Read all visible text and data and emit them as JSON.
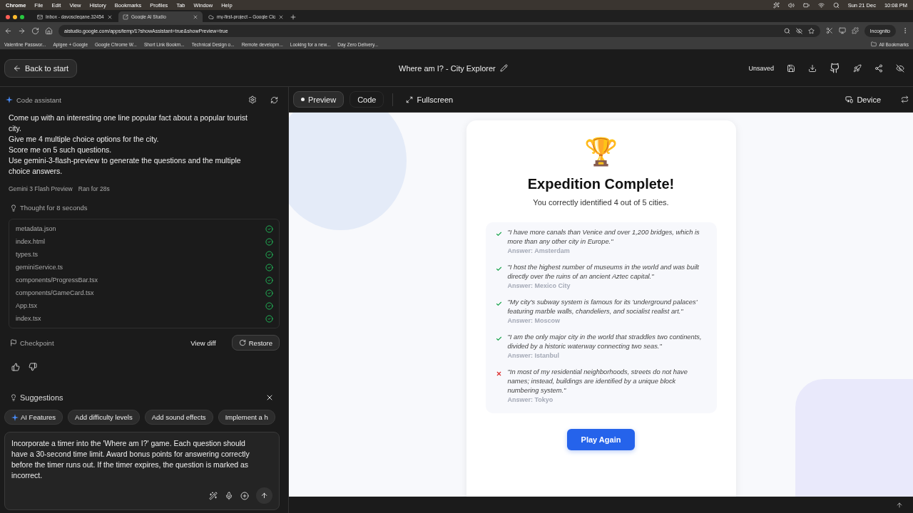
{
  "menu_bar": {
    "app": "Chrome",
    "items": [
      "File",
      "Edit",
      "View",
      "History",
      "Bookmarks",
      "Profiles",
      "Tab",
      "Window",
      "Help"
    ],
    "date": "Sun 21 Dec",
    "time": "10:08 PM"
  },
  "browser": {
    "tabs": [
      {
        "title": "Inbox - davosclegane.32454",
        "selected": false,
        "kind": "mail"
      },
      {
        "title": "Google AI Studio",
        "selected": true,
        "kind": "studio"
      },
      {
        "title": "my-first-project – Google Clo",
        "selected": false,
        "kind": "cloud"
      }
    ],
    "url": "aistudio.google.com/apps/temp/1?showAssistant=true&showPreview=true",
    "profile": "Incognito",
    "bookmarks": [
      "Valentine Passwor...",
      "Apigee + Google",
      "Google Chrome W...",
      "Short Link Bookm...",
      "Technical Design o...",
      "Remote developm...",
      "Looking for a new...",
      "Day Zero Delivery..."
    ],
    "all_bookmarks": "All Bookmarks"
  },
  "header": {
    "back": "Back to start",
    "project_title": "Where am I? - City Explorer",
    "status": "Unsaved"
  },
  "assistant": {
    "title": "Code assistant",
    "message": [
      "Come up with an interesting one line popular fact about a popular tourist city.",
      "Give me 4 multiple choice options for the city.",
      "Score me on 5 such questions.",
      "Use gemini-3-flash-preview to generate the questions and the multiple choice answers."
    ],
    "model": "Gemini 3 Flash Preview",
    "run_time": "Ran for 28s",
    "thought": "Thought for 8 seconds",
    "files": [
      {
        "name": "metadata.json",
        "done": true
      },
      {
        "name": "index.html",
        "done": true
      },
      {
        "name": "types.ts",
        "done": true
      },
      {
        "name": "geminiService.ts",
        "done": true
      },
      {
        "name": "components/ProgressBar.tsx",
        "done": true
      },
      {
        "name": "components/GameCard.tsx",
        "done": true
      },
      {
        "name": "App.tsx",
        "done": true
      },
      {
        "name": "index.tsx",
        "done": true
      }
    ],
    "checkpoint": "Checkpoint",
    "view_diff": "View diff",
    "restore": "Restore",
    "suggestions_title": "Suggestions",
    "suggestions": [
      {
        "label": "AI Features",
        "kind": "ai"
      },
      {
        "label": "Add difficulty levels",
        "kind": "plain"
      },
      {
        "label": "Add sound effects",
        "kind": "plain"
      },
      {
        "label": "Implement a h",
        "kind": "plain"
      }
    ],
    "prompt": "Incorporate a timer into the 'Where am I?' game. Each question should have a 30-second time limit. Award bonus points for answering correctly before the timer runs out. If the timer expires, the question is marked as incorrect."
  },
  "preview_toolbar": {
    "tabs": [
      {
        "label": "Preview",
        "selected": true
      },
      {
        "label": "Code",
        "selected": false
      }
    ],
    "fullscreen": "Fullscreen",
    "device": "Device"
  },
  "result": {
    "trophy": "🏆",
    "title": "Expedition Complete!",
    "summary": "You correctly identified 4 out of 5 cities.",
    "items": [
      {
        "fact": "\"I have more canals than Venice and over 1,200 bridges, which is more than any other city in Europe.\"",
        "answer": "Answer: Amsterdam",
        "correct": true
      },
      {
        "fact": "\"I host the highest number of museums in the world and was built directly over the ruins of an ancient Aztec capital.\"",
        "answer": "Answer: Mexico City",
        "correct": true
      },
      {
        "fact": "\"My city's subway system is famous for its 'underground palaces' featuring marble walls, chandeliers, and socialist realist art.\"",
        "answer": "Answer: Moscow",
        "correct": true
      },
      {
        "fact": "\"I am the only major city in the world that straddles two continents, divided by a historic waterway connecting two seas.\"",
        "answer": "Answer: Istanbul",
        "correct": true
      },
      {
        "fact": "\"In most of my residential neighborhoods, streets do not have names; instead, buildings are identified by a unique block numbering system.\"",
        "answer": "Answer: Tokyo",
        "correct": false
      }
    ],
    "button": "Play Again"
  }
}
